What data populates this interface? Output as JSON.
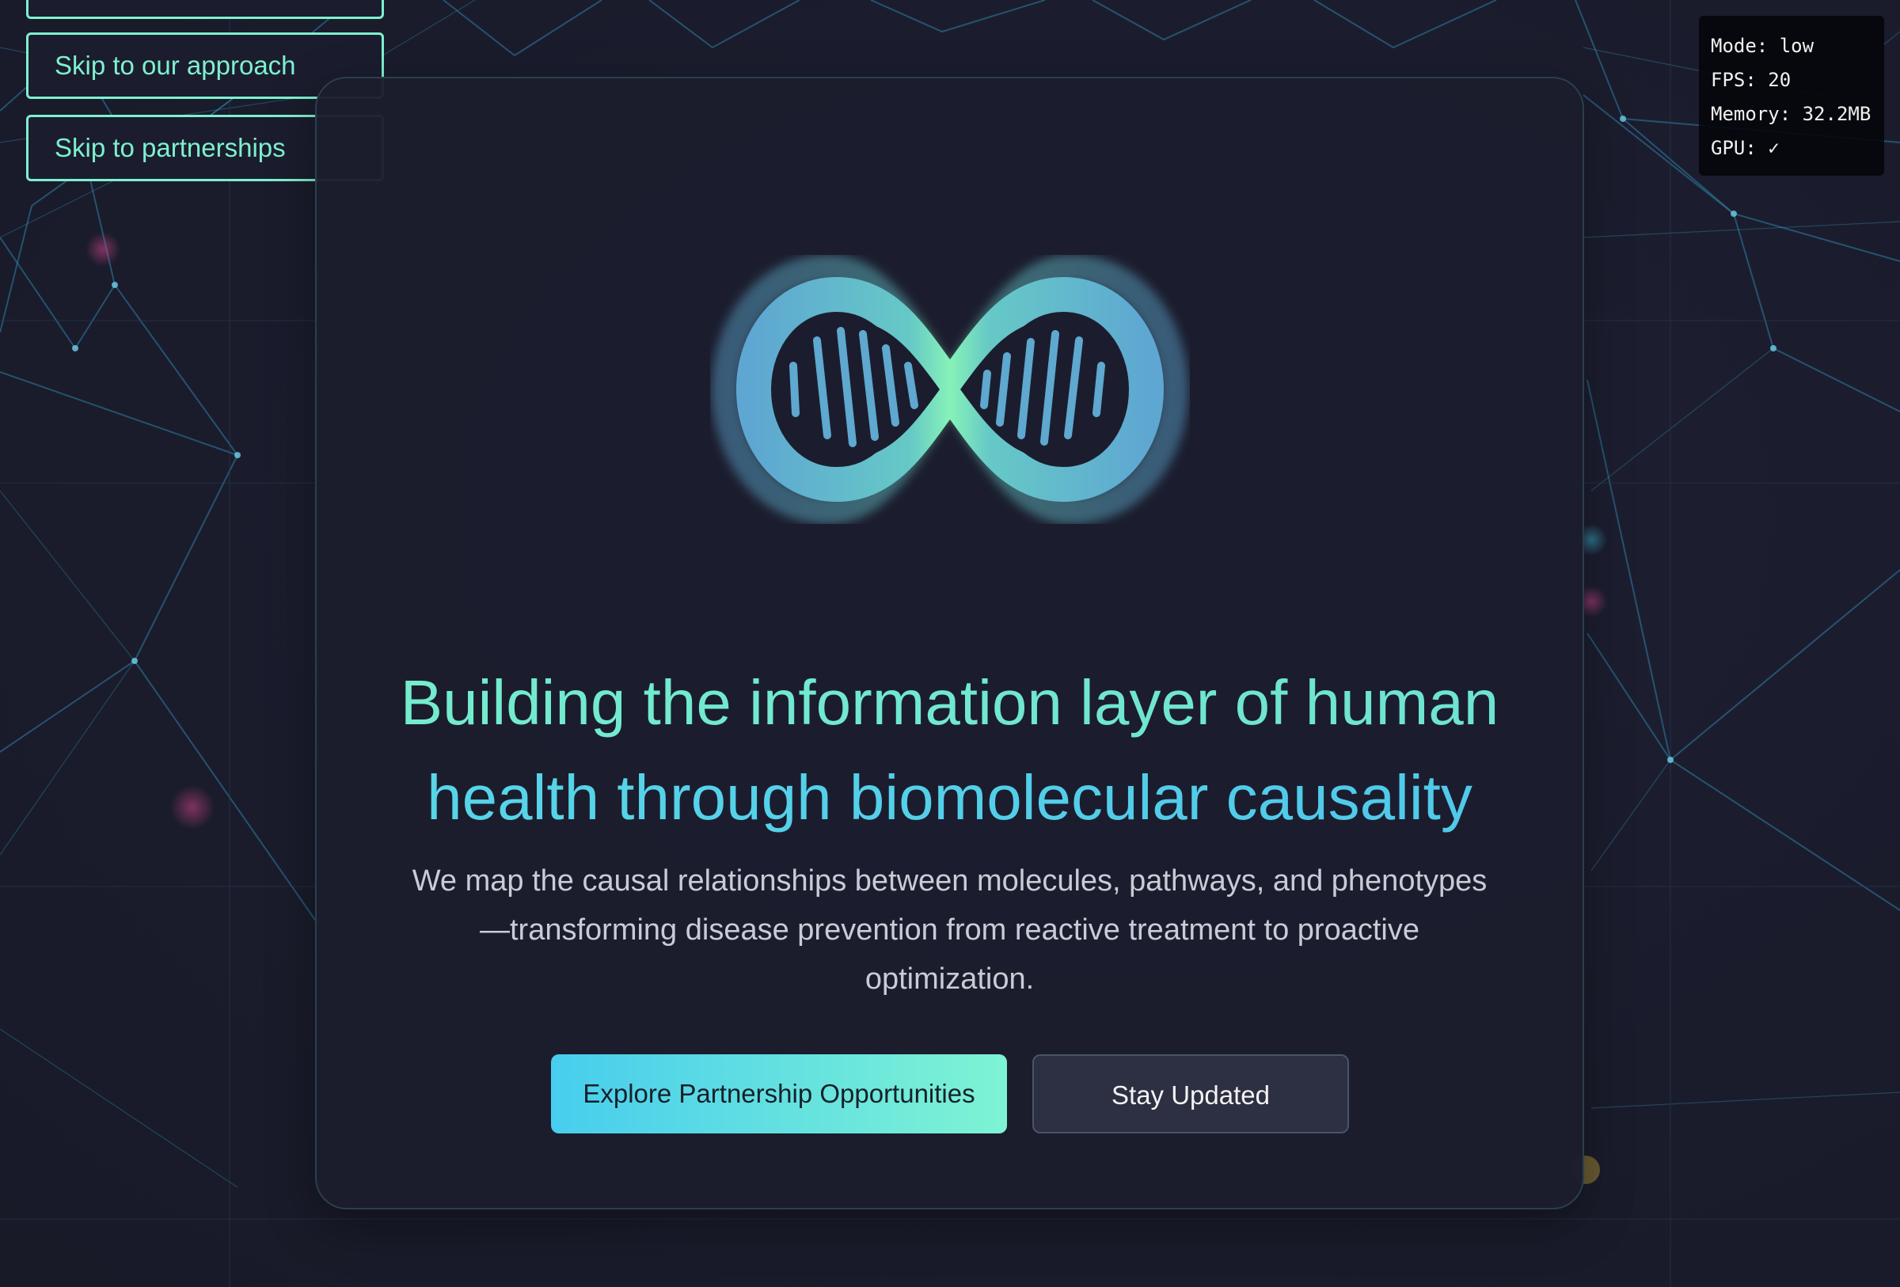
{
  "skip_links": {
    "approach_label": "Skip to our approach",
    "partnerships_label": "Skip to partnerships"
  },
  "perf_monitor": {
    "mode": "Mode: low",
    "fps": "FPS: 20",
    "memory": "Memory: 32.2MB",
    "gpu": "GPU: ✓"
  },
  "hero": {
    "logo_icon": "dna-infinity-icon",
    "headline_line1": "Building the information layer of human",
    "headline_line2": "health through biomolecular causality",
    "subtext": "We map the causal relationships between molecules, pathways, and phenotypes —transforming disease prevention from reactive treatment to proactive optimization.",
    "primary_button": "Explore Partnership Opportunities",
    "secondary_button": "Stay Updated"
  },
  "colors": {
    "background": "#1b1d2e",
    "accent_green": "#7ef0cf",
    "accent_cyan": "#4fc8ea",
    "body_text": "#c9cbd6"
  }
}
